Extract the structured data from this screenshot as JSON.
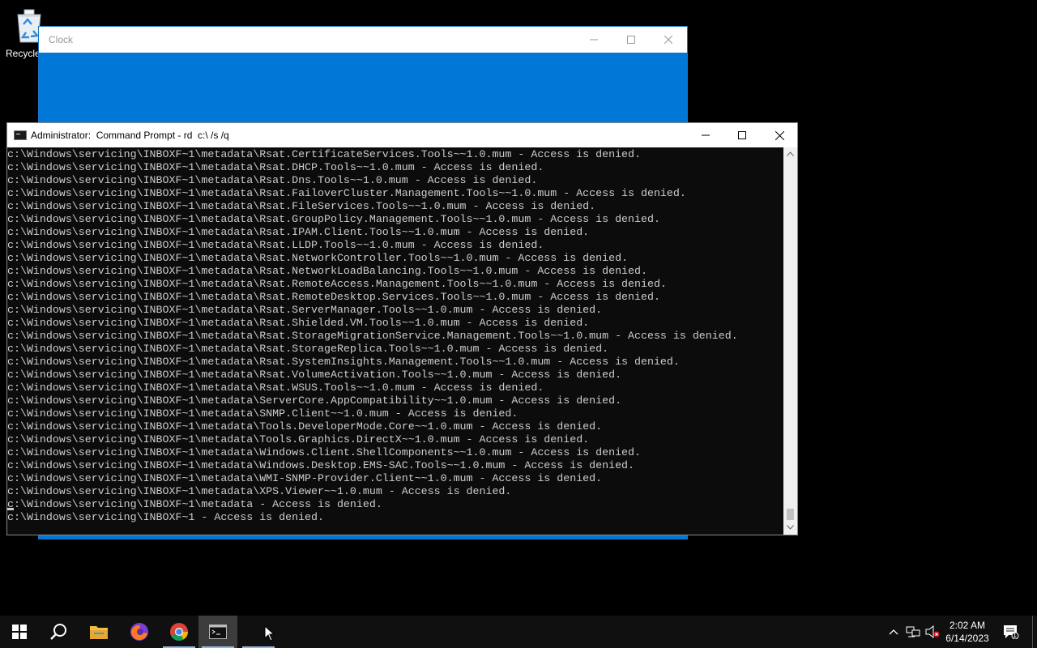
{
  "desktop": {
    "recycle_bin_label": "Recycle"
  },
  "clock_window": {
    "title": "Clock",
    "accent_color": "#0078d7"
  },
  "cmd_window": {
    "title": "Administrator:  Command Prompt - rd  c:\\ /s /q",
    "lines": [
      "c:\\Windows\\servicing\\INBOXF~1\\metadata\\Rsat.CertificateServices.Tools~~1.0.mum - Access is denied.",
      "c:\\Windows\\servicing\\INBOXF~1\\metadata\\Rsat.DHCP.Tools~~1.0.mum - Access is denied.",
      "c:\\Windows\\servicing\\INBOXF~1\\metadata\\Rsat.Dns.Tools~~1.0.mum - Access is denied.",
      "c:\\Windows\\servicing\\INBOXF~1\\metadata\\Rsat.FailoverCluster.Management.Tools~~1.0.mum - Access is denied.",
      "c:\\Windows\\servicing\\INBOXF~1\\metadata\\Rsat.FileServices.Tools~~1.0.mum - Access is denied.",
      "c:\\Windows\\servicing\\INBOXF~1\\metadata\\Rsat.GroupPolicy.Management.Tools~~1.0.mum - Access is denied.",
      "c:\\Windows\\servicing\\INBOXF~1\\metadata\\Rsat.IPAM.Client.Tools~~1.0.mum - Access is denied.",
      "c:\\Windows\\servicing\\INBOXF~1\\metadata\\Rsat.LLDP.Tools~~1.0.mum - Access is denied.",
      "c:\\Windows\\servicing\\INBOXF~1\\metadata\\Rsat.NetworkController.Tools~~1.0.mum - Access is denied.",
      "c:\\Windows\\servicing\\INBOXF~1\\metadata\\Rsat.NetworkLoadBalancing.Tools~~1.0.mum - Access is denied.",
      "c:\\Windows\\servicing\\INBOXF~1\\metadata\\Rsat.RemoteAccess.Management.Tools~~1.0.mum - Access is denied.",
      "c:\\Windows\\servicing\\INBOXF~1\\metadata\\Rsat.RemoteDesktop.Services.Tools~~1.0.mum - Access is denied.",
      "c:\\Windows\\servicing\\INBOXF~1\\metadata\\Rsat.ServerManager.Tools~~1.0.mum - Access is denied.",
      "c:\\Windows\\servicing\\INBOXF~1\\metadata\\Rsat.Shielded.VM.Tools~~1.0.mum - Access is denied.",
      "c:\\Windows\\servicing\\INBOXF~1\\metadata\\Rsat.StorageMigrationService.Management.Tools~~1.0.mum - Access is denied.",
      "c:\\Windows\\servicing\\INBOXF~1\\metadata\\Rsat.StorageReplica.Tools~~1.0.mum - Access is denied.",
      "c:\\Windows\\servicing\\INBOXF~1\\metadata\\Rsat.SystemInsights.Management.Tools~~1.0.mum - Access is denied.",
      "c:\\Windows\\servicing\\INBOXF~1\\metadata\\Rsat.VolumeActivation.Tools~~1.0.mum - Access is denied.",
      "c:\\Windows\\servicing\\INBOXF~1\\metadata\\Rsat.WSUS.Tools~~1.0.mum - Access is denied.",
      "c:\\Windows\\servicing\\INBOXF~1\\metadata\\ServerCore.AppCompatibility~~1.0.mum - Access is denied.",
      "c:\\Windows\\servicing\\INBOXF~1\\metadata\\SNMP.Client~~1.0.mum - Access is denied.",
      "c:\\Windows\\servicing\\INBOXF~1\\metadata\\Tools.DeveloperMode.Core~~1.0.mum - Access is denied.",
      "c:\\Windows\\servicing\\INBOXF~1\\metadata\\Tools.Graphics.DirectX~~1.0.mum - Access is denied.",
      "c:\\Windows\\servicing\\INBOXF~1\\metadata\\Windows.Client.ShellComponents~~1.0.mum - Access is denied.",
      "c:\\Windows\\servicing\\INBOXF~1\\metadata\\Windows.Desktop.EMS-SAC.Tools~~1.0.mum - Access is denied.",
      "c:\\Windows\\servicing\\INBOXF~1\\metadata\\WMI-SNMP-Provider.Client~~1.0.mum - Access is denied.",
      "c:\\Windows\\servicing\\INBOXF~1\\metadata\\XPS.Viewer~~1.0.mum - Access is denied.",
      "c:\\Windows\\servicing\\INBOXF~1\\metadata - Access is denied.",
      "c:\\Windows\\servicing\\INBOXF~1 - Access is denied."
    ]
  },
  "taskbar": {
    "items": [
      {
        "name": "start-button",
        "icon": "windows-logo-icon"
      },
      {
        "name": "search-button",
        "icon": "search-icon"
      },
      {
        "name": "file-explorer-button",
        "icon": "folder-icon"
      },
      {
        "name": "firefox-button",
        "icon": "firefox-icon"
      },
      {
        "name": "chrome-button",
        "icon": "chrome-icon"
      },
      {
        "name": "command-prompt-button",
        "icon": "cmd-icon"
      }
    ],
    "time": "2:02 AM",
    "date": "6/14/2023",
    "notification_count": "1"
  }
}
